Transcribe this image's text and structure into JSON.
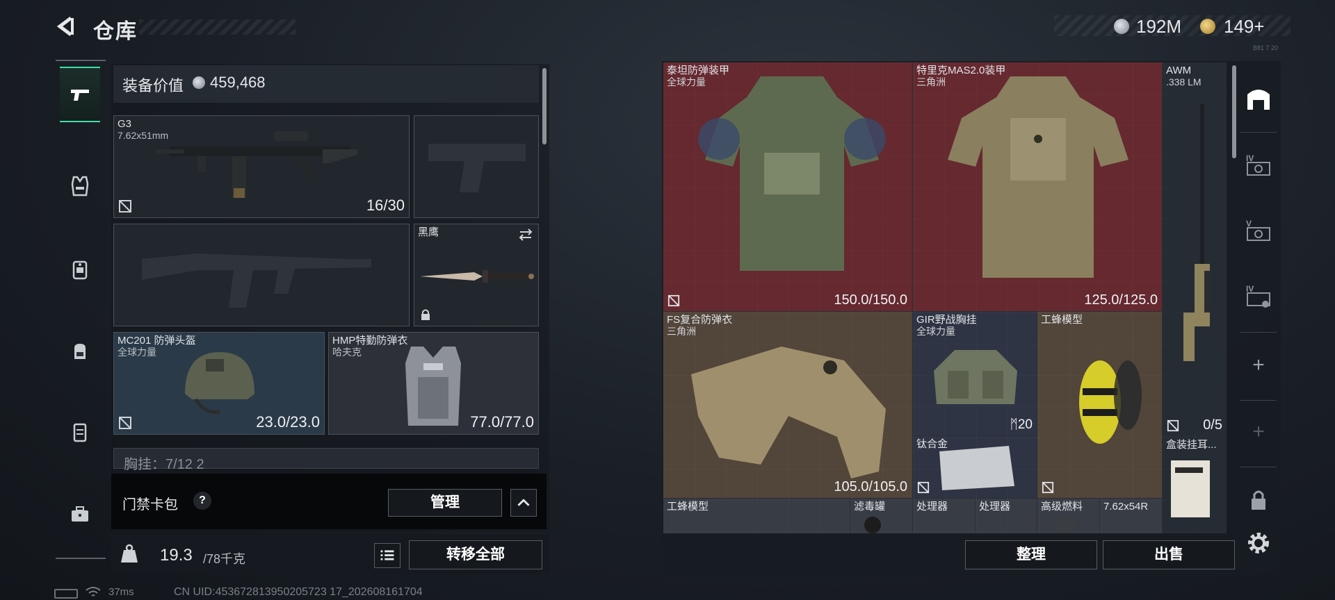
{
  "header": {
    "title": "仓库",
    "currency1": "192M",
    "currency2": "149+",
    "tiny_note": "B81 7 20"
  },
  "loadout": {
    "equip_value_label": "装备价值",
    "equip_value": "459,468",
    "slots": {
      "g3": {
        "name": "G3",
        "sub": "7.62x51mm",
        "value": "16/30"
      },
      "knife": {
        "name": "黑鹰"
      },
      "helmet": {
        "name": "MC201 防弹头盔",
        "sub": "全球力量",
        "value": "23.0/23.0"
      },
      "vest": {
        "name": "HMP特勤防弹衣",
        "sub": "哈夫克",
        "value": "77.0/77.0"
      }
    },
    "chest_row": "胸挂：7/12  2",
    "keycard_label": "门禁卡包",
    "keycard_help": "?",
    "manage_btn": "管理",
    "weight_value": "19.3",
    "weight_max": "/78千克",
    "transfer_btn": "转移全部"
  },
  "status": {
    "ping": "37ms",
    "uid": "CN UID:453672813950205723 17_202608161704"
  },
  "storage": {
    "items": {
      "titan": {
        "name": "泰坦防弹装甲",
        "sub": "全球力量",
        "value": "150.0/150.0"
      },
      "trek": {
        "name": "特里克MAS2.0装甲",
        "sub": "三角洲",
        "value": "125.0/125.0"
      },
      "awm": {
        "name": "AWM",
        "sub": ".338 LM",
        "value": "0/5"
      },
      "fs": {
        "name": "FS复合防弹衣",
        "sub": "三角洲",
        "value": "105.0/105.0"
      },
      "gir": {
        "name": "GIR野战胸挂",
        "sub": "全球力量",
        "value": "20"
      },
      "bee": {
        "name": "工蜂模型"
      },
      "alloy": {
        "name": "钛合金"
      },
      "earbox": {
        "name": "盒装挂耳..."
      },
      "bottom": [
        "工蜂模型",
        "滤毒罐",
        "处理器",
        "处理器",
        "高级燃料",
        "7.62x54R"
      ]
    },
    "sort_btn": "整理",
    "sell_btn": "出售"
  },
  "right_rail": {
    "labels": [
      "IV",
      "V",
      "IV"
    ],
    "plus": "+"
  },
  "colors": {
    "accent": "#3be0a6",
    "red_cell": "#7a282e",
    "brown_cell": "#604e3c",
    "slate_cell": "#303648"
  }
}
